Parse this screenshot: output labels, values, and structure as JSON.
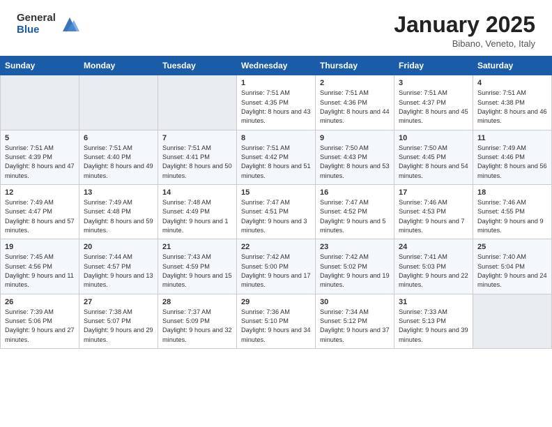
{
  "logo": {
    "general": "General",
    "blue": "Blue"
  },
  "header": {
    "month": "January 2025",
    "location": "Bibano, Veneto, Italy"
  },
  "weekdays": [
    "Sunday",
    "Monday",
    "Tuesday",
    "Wednesday",
    "Thursday",
    "Friday",
    "Saturday"
  ],
  "weeks": [
    [
      {
        "day": "",
        "info": ""
      },
      {
        "day": "",
        "info": ""
      },
      {
        "day": "",
        "info": ""
      },
      {
        "day": "1",
        "info": "Sunrise: 7:51 AM\nSunset: 4:35 PM\nDaylight: 8 hours and 43 minutes."
      },
      {
        "day": "2",
        "info": "Sunrise: 7:51 AM\nSunset: 4:36 PM\nDaylight: 8 hours and 44 minutes."
      },
      {
        "day": "3",
        "info": "Sunrise: 7:51 AM\nSunset: 4:37 PM\nDaylight: 8 hours and 45 minutes."
      },
      {
        "day": "4",
        "info": "Sunrise: 7:51 AM\nSunset: 4:38 PM\nDaylight: 8 hours and 46 minutes."
      }
    ],
    [
      {
        "day": "5",
        "info": "Sunrise: 7:51 AM\nSunset: 4:39 PM\nDaylight: 8 hours and 47 minutes."
      },
      {
        "day": "6",
        "info": "Sunrise: 7:51 AM\nSunset: 4:40 PM\nDaylight: 8 hours and 49 minutes."
      },
      {
        "day": "7",
        "info": "Sunrise: 7:51 AM\nSunset: 4:41 PM\nDaylight: 8 hours and 50 minutes."
      },
      {
        "day": "8",
        "info": "Sunrise: 7:51 AM\nSunset: 4:42 PM\nDaylight: 8 hours and 51 minutes."
      },
      {
        "day": "9",
        "info": "Sunrise: 7:50 AM\nSunset: 4:43 PM\nDaylight: 8 hours and 53 minutes."
      },
      {
        "day": "10",
        "info": "Sunrise: 7:50 AM\nSunset: 4:45 PM\nDaylight: 8 hours and 54 minutes."
      },
      {
        "day": "11",
        "info": "Sunrise: 7:49 AM\nSunset: 4:46 PM\nDaylight: 8 hours and 56 minutes."
      }
    ],
    [
      {
        "day": "12",
        "info": "Sunrise: 7:49 AM\nSunset: 4:47 PM\nDaylight: 8 hours and 57 minutes."
      },
      {
        "day": "13",
        "info": "Sunrise: 7:49 AM\nSunset: 4:48 PM\nDaylight: 8 hours and 59 minutes."
      },
      {
        "day": "14",
        "info": "Sunrise: 7:48 AM\nSunset: 4:49 PM\nDaylight: 9 hours and 1 minute."
      },
      {
        "day": "15",
        "info": "Sunrise: 7:47 AM\nSunset: 4:51 PM\nDaylight: 9 hours and 3 minutes."
      },
      {
        "day": "16",
        "info": "Sunrise: 7:47 AM\nSunset: 4:52 PM\nDaylight: 9 hours and 5 minutes."
      },
      {
        "day": "17",
        "info": "Sunrise: 7:46 AM\nSunset: 4:53 PM\nDaylight: 9 hours and 7 minutes."
      },
      {
        "day": "18",
        "info": "Sunrise: 7:46 AM\nSunset: 4:55 PM\nDaylight: 9 hours and 9 minutes."
      }
    ],
    [
      {
        "day": "19",
        "info": "Sunrise: 7:45 AM\nSunset: 4:56 PM\nDaylight: 9 hours and 11 minutes."
      },
      {
        "day": "20",
        "info": "Sunrise: 7:44 AM\nSunset: 4:57 PM\nDaylight: 9 hours and 13 minutes."
      },
      {
        "day": "21",
        "info": "Sunrise: 7:43 AM\nSunset: 4:59 PM\nDaylight: 9 hours and 15 minutes."
      },
      {
        "day": "22",
        "info": "Sunrise: 7:42 AM\nSunset: 5:00 PM\nDaylight: 9 hours and 17 minutes."
      },
      {
        "day": "23",
        "info": "Sunrise: 7:42 AM\nSunset: 5:02 PM\nDaylight: 9 hours and 19 minutes."
      },
      {
        "day": "24",
        "info": "Sunrise: 7:41 AM\nSunset: 5:03 PM\nDaylight: 9 hours and 22 minutes."
      },
      {
        "day": "25",
        "info": "Sunrise: 7:40 AM\nSunset: 5:04 PM\nDaylight: 9 hours and 24 minutes."
      }
    ],
    [
      {
        "day": "26",
        "info": "Sunrise: 7:39 AM\nSunset: 5:06 PM\nDaylight: 9 hours and 27 minutes."
      },
      {
        "day": "27",
        "info": "Sunrise: 7:38 AM\nSunset: 5:07 PM\nDaylight: 9 hours and 29 minutes."
      },
      {
        "day": "28",
        "info": "Sunrise: 7:37 AM\nSunset: 5:09 PM\nDaylight: 9 hours and 32 minutes."
      },
      {
        "day": "29",
        "info": "Sunrise: 7:36 AM\nSunset: 5:10 PM\nDaylight: 9 hours and 34 minutes."
      },
      {
        "day": "30",
        "info": "Sunrise: 7:34 AM\nSunset: 5:12 PM\nDaylight: 9 hours and 37 minutes."
      },
      {
        "day": "31",
        "info": "Sunrise: 7:33 AM\nSunset: 5:13 PM\nDaylight: 9 hours and 39 minutes."
      },
      {
        "day": "",
        "info": ""
      }
    ]
  ]
}
